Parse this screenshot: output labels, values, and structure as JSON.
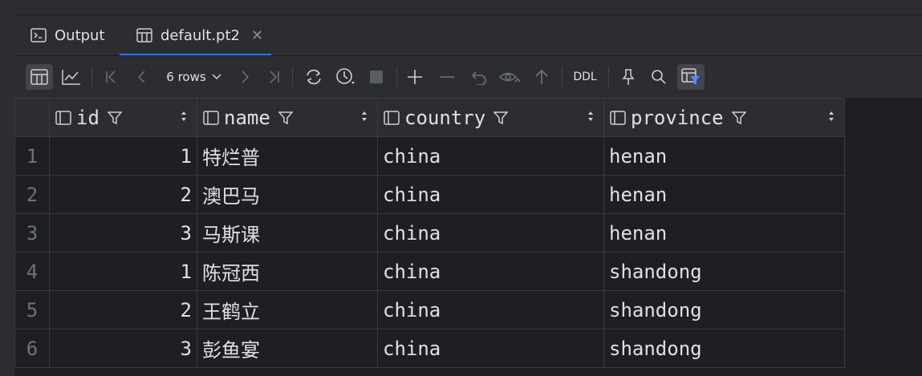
{
  "tabs": [
    {
      "label": "Output",
      "icon": "terminal-icon"
    },
    {
      "label": "default.pt2",
      "icon": "table-icon",
      "active": true
    }
  ],
  "toolbar": {
    "rows_label": "6 rows",
    "ddl_label": "DDL"
  },
  "table": {
    "columns": [
      "id",
      "name",
      "country",
      "province"
    ],
    "rows": [
      {
        "num": "1",
        "id": "1",
        "name": "特烂普",
        "country": "china",
        "province": "henan"
      },
      {
        "num": "2",
        "id": "2",
        "name": "澳巴马",
        "country": "china",
        "province": "henan"
      },
      {
        "num": "3",
        "id": "3",
        "name": "马斯课",
        "country": "china",
        "province": "henan"
      },
      {
        "num": "4",
        "id": "1",
        "name": "陈冠西",
        "country": "china",
        "province": "shandong"
      },
      {
        "num": "5",
        "id": "2",
        "name": "王鹤立",
        "country": "china",
        "province": "shandong"
      },
      {
        "num": "6",
        "id": "3",
        "name": "彭鱼宴",
        "country": "china",
        "province": "shandong"
      }
    ]
  },
  "colors": {
    "accent": "#3574f0",
    "background": "#1e1f22",
    "panel": "#2b2d30"
  }
}
